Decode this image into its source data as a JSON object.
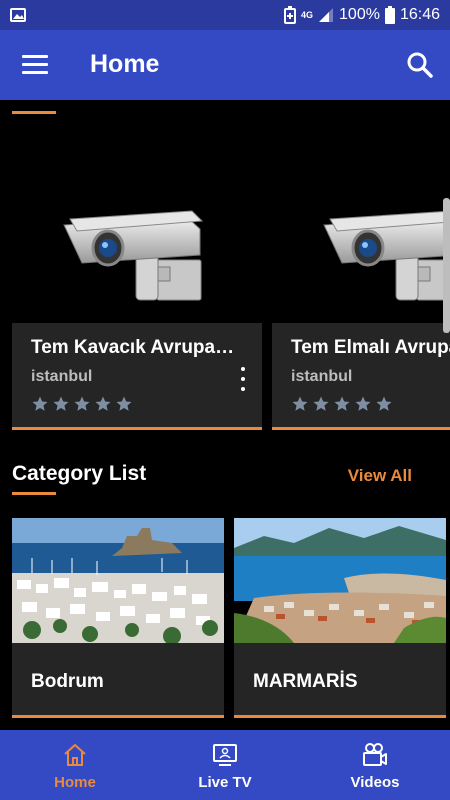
{
  "status_bar": {
    "network": "4G",
    "battery": "100%",
    "time": "16:46"
  },
  "app_bar": {
    "title": "Home"
  },
  "cameras": [
    {
      "title": "Tem Kavacık Avrupa…",
      "city": "istanbul",
      "rating": 0
    },
    {
      "title": "Tem Elmalı Avrupa",
      "city": "istanbul",
      "rating": 0
    }
  ],
  "category_section": {
    "title": "Category List",
    "view_all": "View All",
    "items": [
      {
        "name": "Bodrum"
      },
      {
        "name": "MARMARİS"
      }
    ]
  },
  "bottom_nav": {
    "items": [
      {
        "label": "Home",
        "icon": "home-icon",
        "active": true
      },
      {
        "label": "Live TV",
        "icon": "tv-icon",
        "active": false
      },
      {
        "label": "Videos",
        "icon": "video-camera-icon",
        "active": false
      }
    ]
  },
  "colors": {
    "primary": "#3449c4",
    "status_bar": "#2b3a9f",
    "accent": "#e98a3c",
    "card": "#252525"
  }
}
